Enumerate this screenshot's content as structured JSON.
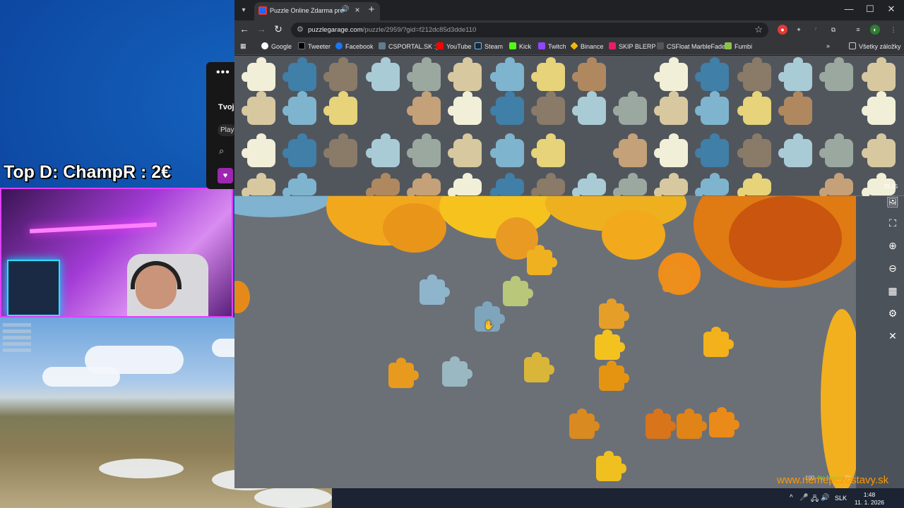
{
  "overlay": {
    "streamer_title": "Top D: ChampR : 2€",
    "watermark": "www.nemepczostavy.sk",
    "game_hud": {
      "ping": "100",
      "player": "Ne Name",
      "score": "71"
    }
  },
  "side_app": {
    "menu": "•••",
    "title": "Tvoj",
    "pill": "Play",
    "search_glyph": "⌕",
    "heart_glyph": "♥"
  },
  "browser": {
    "tab": {
      "title": "Puzzle Online Zdarma pre Dospelých",
      "audio": "🔊",
      "close": "×"
    },
    "new_tab": "+",
    "window": {
      "minimize": "—",
      "maximize": "☐",
      "close": "✕"
    },
    "nav": {
      "back": "←",
      "forward": "→",
      "reload": "↻"
    },
    "url": {
      "host": "puzzlegarage.com",
      "path": "/puzzle/2959/?gid=f212dc85d3dde110"
    },
    "bookmarks": [
      {
        "label": "Google",
        "color": "#4285f4"
      },
      {
        "label": "Tweeter",
        "color": "#000000"
      },
      {
        "label": "Facebook",
        "color": "#1877f2"
      },
      {
        "label": "CSPORTAL.SK :)",
        "color": "#607d8b"
      },
      {
        "label": "YouTube",
        "color": "#ff0000"
      },
      {
        "label": "Steam",
        "color": "#1b2838"
      },
      {
        "label": "Kick",
        "color": "#53fc18"
      },
      {
        "label": "Twitch",
        "color": "#9146ff"
      },
      {
        "label": "Binance",
        "color": "#f0b90b"
      },
      {
        "label": "SKIP BLERP",
        "color": "#e91e63"
      },
      {
        "label": "CSFloat MarbleFade",
        "color": "#555555"
      },
      {
        "label": "Fumbi",
        "color": "#8bc34a"
      }
    ],
    "bookmarks_folder": "Všetky záložky",
    "bookmarks_more": "»"
  },
  "puzzle": {
    "timer": "39:25",
    "tools": [
      {
        "name": "preview-image-icon",
        "glyph": "🖼"
      },
      {
        "name": "fullscreen-icon",
        "glyph": "⛶"
      },
      {
        "name": "zoom-in-icon",
        "glyph": "⊕"
      },
      {
        "name": "zoom-out-icon",
        "glyph": "⊖"
      },
      {
        "name": "sort-pieces-icon",
        "glyph": "▦"
      },
      {
        "name": "settings-icon",
        "glyph": "⚙"
      },
      {
        "name": "close-icon",
        "glyph": "✕"
      }
    ],
    "cursor_glyph": "✋"
  },
  "taskbar": {
    "lang": "SLK",
    "time": "1:48",
    "date": "11. 1. 2026",
    "icons": [
      "^",
      "🎤",
      "🖧",
      "🔊",
      "🔋"
    ]
  },
  "colors": {
    "accent": "#e040fb",
    "watermark": "#ff9800",
    "board": "#6b7077"
  }
}
